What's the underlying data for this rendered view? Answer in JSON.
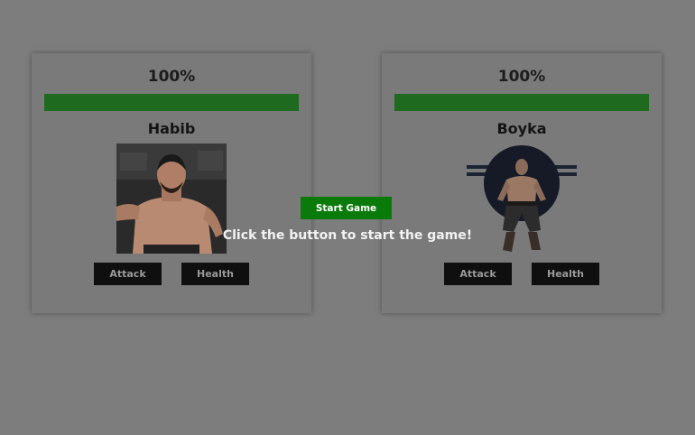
{
  "players": [
    {
      "health_label": "100%",
      "health_fraction": 1.0,
      "name": "Habib",
      "portrait_icon": "fighter-portrait-icon",
      "attack_label": "Attack",
      "health_button_label": "Health"
    },
    {
      "health_label": "100%",
      "health_fraction": 1.0,
      "name": "Boyka",
      "portrait_icon": "fighter-portrait-icon",
      "attack_label": "Attack",
      "health_button_label": "Health"
    }
  ],
  "start_button_label": "Start Game",
  "hint_text": "Click the button to start the game!",
  "colors": {
    "health_bar": "#1e6a1e",
    "start_button": "#0a7a0a",
    "action_button": "#0f0f0f"
  }
}
